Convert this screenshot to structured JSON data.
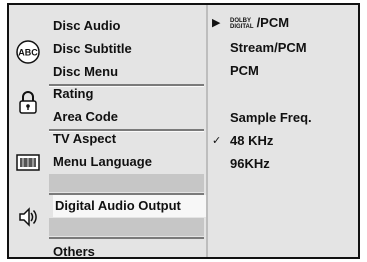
{
  "menu": {
    "groups": [
      {
        "icon": "abc-subtitle-icon",
        "items": [
          "Disc Audio",
          "Disc Subtitle",
          "Disc Menu"
        ]
      },
      {
        "icon": "lock-icon",
        "items": [
          "Rating",
          "Area Code"
        ]
      },
      {
        "icon": "tv-aspect-icon",
        "items": [
          "TV Aspect",
          "Menu Language"
        ]
      },
      {
        "icon": "speaker-icon",
        "items": [
          "Digital Audio Output"
        ]
      },
      {
        "icon": "",
        "items": [
          "Others"
        ]
      }
    ],
    "active_item": "Digital Audio Output"
  },
  "options": {
    "dolby_top": "DOLBY",
    "dolby_bottom": "DIGITAL",
    "dolby_suffix": "/PCM",
    "stream_pcm": "Stream/PCM",
    "pcm": "PCM",
    "sample_freq_label": "Sample Freq.",
    "freq_48": "48 KHz",
    "freq_96": "96KHz",
    "arrow_mark": "▶",
    "check_mark": "✓"
  }
}
